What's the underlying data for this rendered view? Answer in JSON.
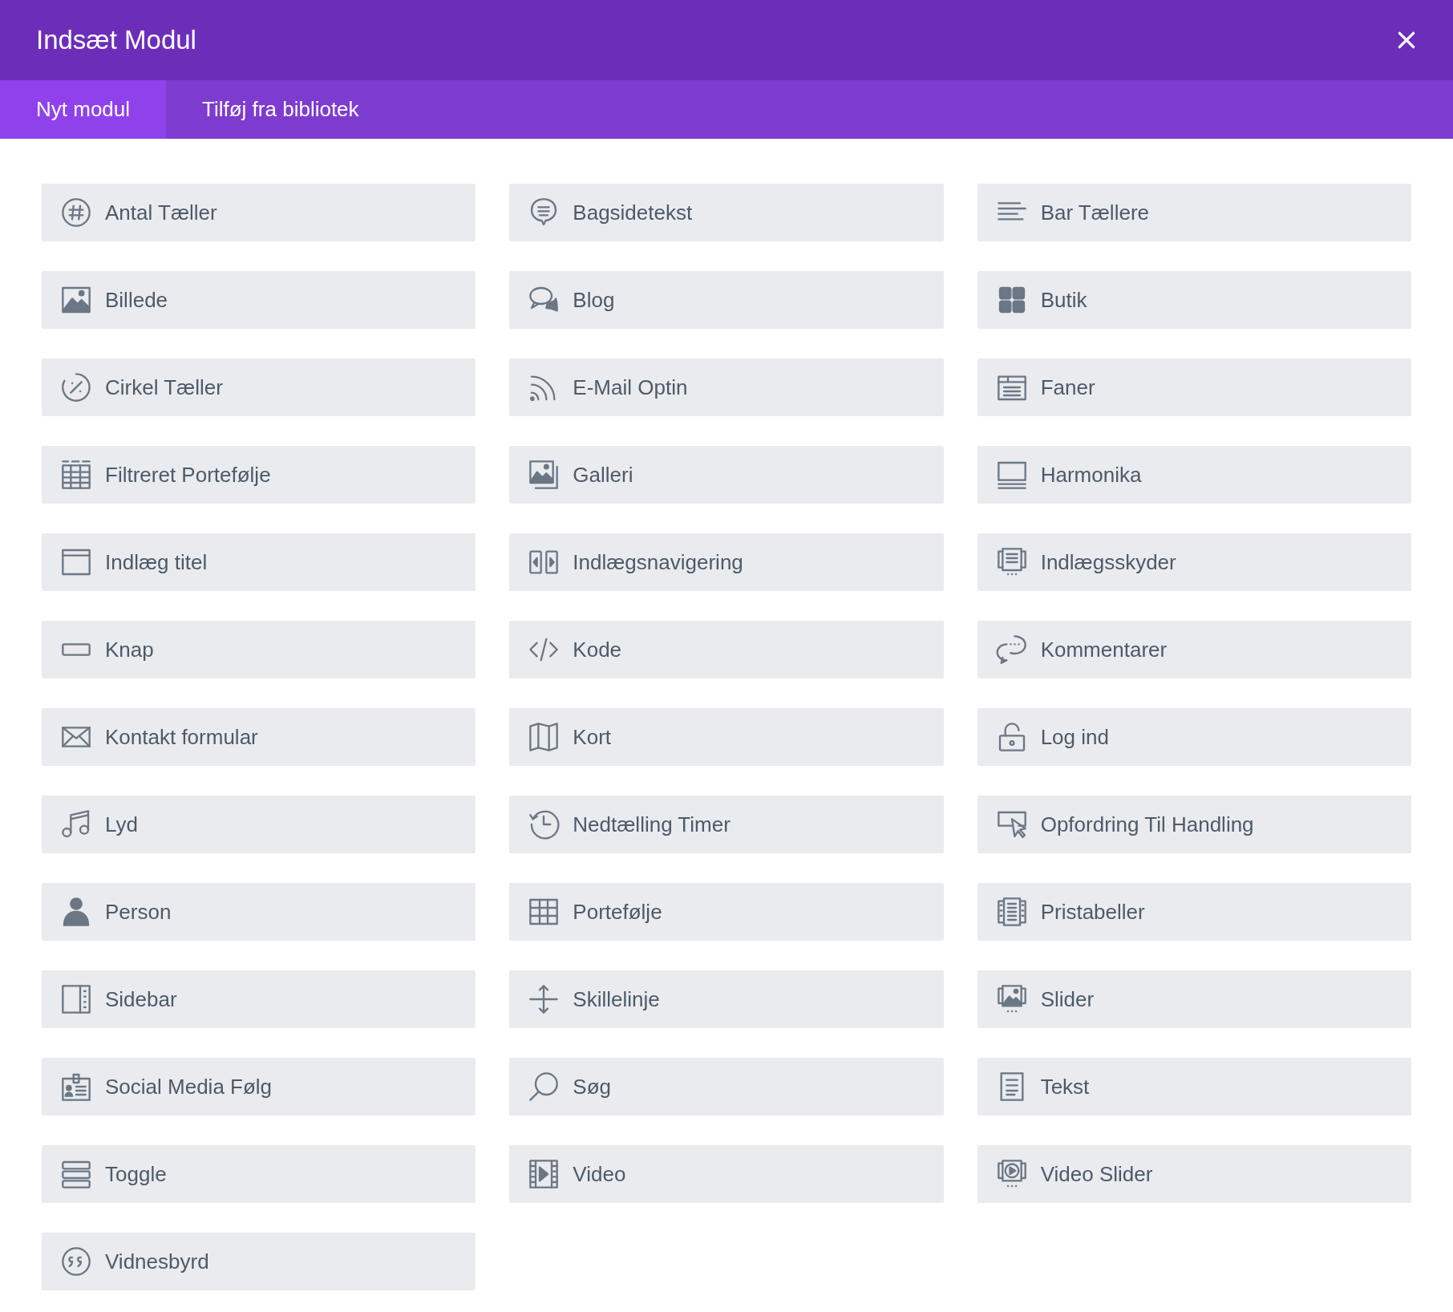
{
  "window": {
    "title": "Indsæt Modul"
  },
  "tabs": [
    {
      "label": "Nyt modul",
      "selected": true
    },
    {
      "label": "Tilføj fra bibliotek",
      "selected": false
    }
  ],
  "modules": [
    {
      "label": "Antal Tæller"
    },
    {
      "label": "Bagsidetekst"
    },
    {
      "label": "Bar Tællere"
    },
    {
      "label": "Billede"
    },
    {
      "label": "Blog"
    },
    {
      "label": "Butik"
    },
    {
      "label": "Cirkel Tæller"
    },
    {
      "label": "E-Mail Optin"
    },
    {
      "label": "Faner"
    },
    {
      "label": "Filtreret Portefølje"
    },
    {
      "label": "Galleri"
    },
    {
      "label": "Harmonika"
    },
    {
      "label": "Indlæg titel"
    },
    {
      "label": "Indlægsnavigering"
    },
    {
      "label": "Indlægsskyder"
    },
    {
      "label": "Knap"
    },
    {
      "label": "Kode"
    },
    {
      "label": "Kommentarer"
    },
    {
      "label": "Kontakt formular"
    },
    {
      "label": "Kort"
    },
    {
      "label": "Log ind"
    },
    {
      "label": "Lyd"
    },
    {
      "label": "Nedtælling Timer"
    },
    {
      "label": "Opfordring Til Handling"
    },
    {
      "label": "Person"
    },
    {
      "label": "Portefølje"
    },
    {
      "label": "Pristabeller"
    },
    {
      "label": "Sidebar"
    },
    {
      "label": "Skillelinje"
    },
    {
      "label": "Slider"
    },
    {
      "label": "Social Media Følg"
    },
    {
      "label": "Søg"
    },
    {
      "label": "Tekst"
    },
    {
      "label": "Toggle"
    },
    {
      "label": "Video"
    },
    {
      "label": "Video Slider"
    },
    {
      "label": "Vidnesbyrd"
    }
  ]
}
